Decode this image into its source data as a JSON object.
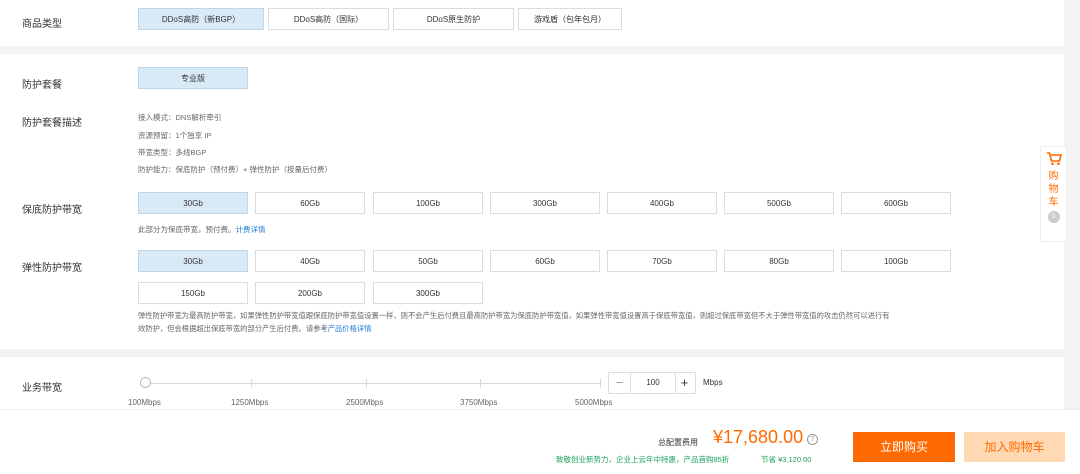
{
  "product_type": {
    "label": "商品类型",
    "options": [
      "DDoS高防（新BGP）",
      "DDoS高防（国际）",
      "DDoS原生防护",
      "游戏盾（包年包月）"
    ]
  },
  "package": {
    "label": "防护套餐",
    "option": "专业版"
  },
  "package_desc": {
    "label": "防护套餐描述",
    "lines": [
      "接入模式：DNS解析牵引",
      "资源预留：1个独享 IP",
      "带宽类型：多线BGP",
      "防护能力：保底防护（预付费）+ 弹性防护（按量后付费）"
    ]
  },
  "base_bw": {
    "label": "保底防护带宽",
    "options": [
      "30Gb",
      "60Gb",
      "100Gb",
      "300Gb",
      "400Gb",
      "500Gb",
      "600Gb"
    ],
    "note": "此部分为保底带宽，预付费。",
    "note_link": "计费详情"
  },
  "elastic_bw": {
    "label": "弹性防护带宽",
    "options": [
      "30Gb",
      "40Gb",
      "50Gb",
      "60Gb",
      "70Gb",
      "80Gb",
      "100Gb",
      "150Gb",
      "200Gb",
      "300Gb"
    ],
    "note_line1": "弹性防护带宽为最高防护带宽，如果弹性防护带宽值跟保底防护带宽值设置一样，则不会产生后付费且最高防护带宽为保底防护带宽值，如果弹性带宽值设置高于保底带宽值，则超过保底带宽但不大于弹性带宽值的攻击仍然可以进行有",
    "note_line2": "效防护，但会根据超出保底带宽的部分产生后付费。请参考",
    "note_link": "产品价格详情"
  },
  "business_bw": {
    "label": "业务带宽",
    "ticks": [
      "100Mbps",
      "1250Mbps",
      "2500Mbps",
      "3750Mbps",
      "5000Mbps"
    ],
    "value": "100",
    "minus": "−",
    "plus": "+",
    "unit": "Mbps",
    "slider_fraction": 0.0
  },
  "cart": {
    "icon": "cart-icon",
    "text": [
      "购",
      "物",
      "车"
    ],
    "count": "0"
  },
  "footer": {
    "total_label": "总配置费用",
    "price": "¥17,680.00",
    "help_icon": "?",
    "promo": "致敬创业新势力，企业上云年中特惠，产品首购85折",
    "save": "节省 ¥3,120.00",
    "buy": "立即购买",
    "add_cart": "加入购物车"
  },
  "colors": {
    "accent": "#ff6a00",
    "selected_bg": "#d9eaf7",
    "link": "#1f7ad6",
    "promo": "#1aa05a",
    "add_cart_bg": "#ffd9b3"
  }
}
